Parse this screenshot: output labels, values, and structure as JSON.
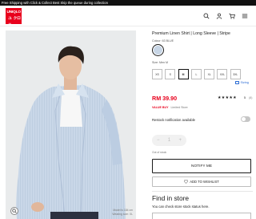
{
  "announcement": "Free Shipping with Click & Collect Best Skip the queue during collection",
  "header": {
    "logo": [
      "UNI",
      "QLO",
      "ユニ",
      "クロ"
    ],
    "icons": [
      "search-icon",
      "user-icon",
      "cart-icon",
      "menu-icon"
    ]
  },
  "image": {
    "caption_line1": "Model is 184 cm",
    "caption_line2": "Wearing size: XL"
  },
  "product": {
    "title": "Premium Linen Shirt | Long Sleeve | Stripe",
    "colour_label": "Colour: 63 BLUE",
    "size_label": "Size: Men M",
    "sizes": [
      "XS",
      "S",
      "M",
      "L",
      "XL",
      "XXL",
      "3XL"
    ],
    "selected_size": "M",
    "fitting_label": "Sizing",
    "price": "RM 39.90",
    "stars": "★★★★★",
    "rating": "5",
    "rating_count": "(8)",
    "flag_value": "VALUE BUY",
    "flag_limited": "Limited Store",
    "restock_label": "Restock notification available",
    "quantity": "1",
    "out_of_stock": "Out of stock",
    "notify_label": "NOTIFY ME",
    "wishlist_label": "ADD TO WISHLIST"
  },
  "store": {
    "title": "Find in store",
    "text": "You can check store stock status here."
  },
  "colors": {
    "brand_red": "#e8001c",
    "swatch": "#c8d6e6",
    "link_blue": "#2b6cd4"
  }
}
